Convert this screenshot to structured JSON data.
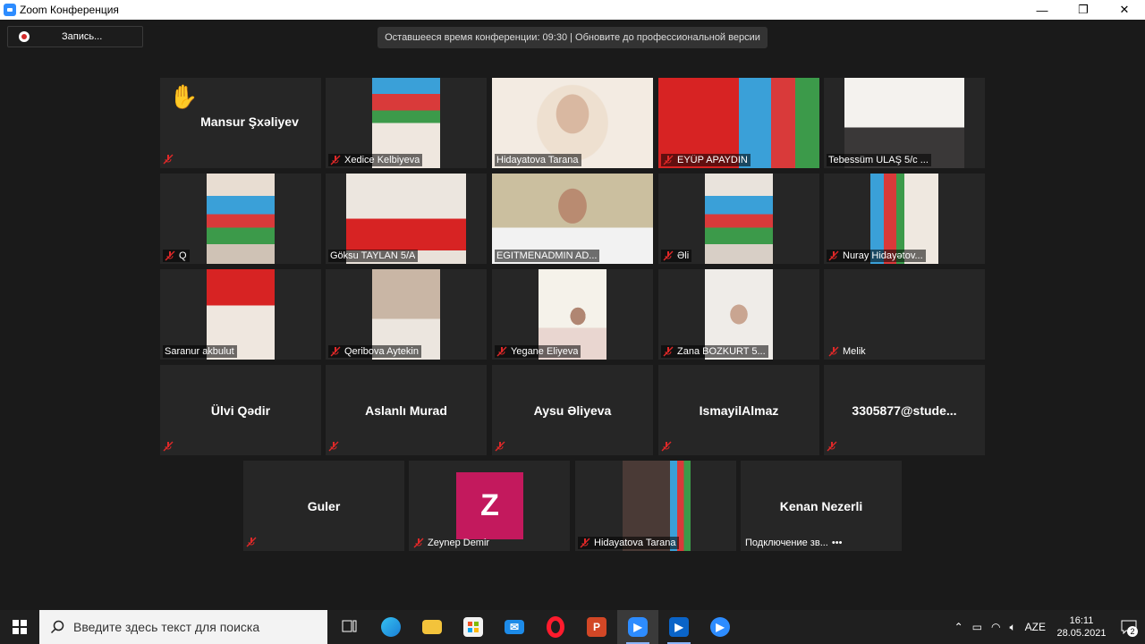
{
  "window": {
    "title": "Zoom Конференция",
    "minimize": "—",
    "restore": "❐",
    "close": "✕"
  },
  "toolbar": {
    "record_label": "Запись..."
  },
  "banner": {
    "text": "Оставшееся время конференции: 09:30 | Обновите до профессиональной версии"
  },
  "participants": [
    {
      "name": "Mansur Şxəliyev",
      "video": false,
      "hand_raised": true,
      "muted": true
    },
    {
      "name": "Xedice Kelbiyeva",
      "video": true,
      "muted": true
    },
    {
      "name": "Hidayatova Tarana",
      "video": true,
      "muted": false
    },
    {
      "name": "EYÜP APAYDIN",
      "video": true,
      "muted": true
    },
    {
      "name": "Tebessüm ULAŞ 5/c ...",
      "video": true,
      "muted": false
    },
    {
      "name": "Q",
      "video": true,
      "muted": true
    },
    {
      "name": "Göksu TAYLAN 5/A",
      "video": true,
      "muted": false
    },
    {
      "name": "EGITMENADMIN AD...",
      "video": true,
      "muted": false,
      "active_speaker": true
    },
    {
      "name": "Əli",
      "video": true,
      "muted": true
    },
    {
      "name": "Nuray Hidayətov...",
      "video": true,
      "muted": true
    },
    {
      "name": "Saranur akbulut",
      "video": true,
      "muted": false
    },
    {
      "name": "Qeribova Aytekin",
      "video": true,
      "muted": true
    },
    {
      "name": "Yegane Eliyeva",
      "video": true,
      "muted": true
    },
    {
      "name": "Zana BOZKURT 5...",
      "video": true,
      "muted": true
    },
    {
      "name": "Melik",
      "video": false,
      "muted": true
    },
    {
      "name": "Ülvi Qədir",
      "video": false,
      "muted": true
    },
    {
      "name": "Aslanlı Murad",
      "video": false,
      "muted": true
    },
    {
      "name": "Aysu Əliyeva",
      "video": false,
      "muted": true
    },
    {
      "name": "IsmayilAlmaz",
      "video": false,
      "muted": true
    },
    {
      "name": "3305877@stude...",
      "video": false,
      "muted": true
    },
    {
      "name": "Guler",
      "video": false,
      "muted": true
    },
    {
      "name": "Zeynep Demir",
      "video": false,
      "avatar_letter": "Z",
      "avatar_color": "#c3195d",
      "muted": true
    },
    {
      "name": "Hidayatova Tarana",
      "video": true,
      "muted": true
    },
    {
      "name": "Kenan Nezerli",
      "video": false,
      "muted": false,
      "status": "Подключение зв...",
      "more": "•••"
    }
  ],
  "taskbar": {
    "search_placeholder": "Введите здесь текст для поиска",
    "apps": [
      "task-view",
      "edge",
      "file-explorer",
      "store",
      "mail",
      "opera",
      "powerpoint",
      "zoom",
      "media-player",
      "zoom-meetings"
    ],
    "language": "AZE",
    "time": "16:11",
    "date": "28.05.2021",
    "notifications": "2"
  },
  "colors": {
    "background": "#1a1a1a",
    "tile": "#262626",
    "active_speaker": "#c9e35a",
    "mute_icon": "#e02828",
    "zoom_blue": "#2d8cff"
  }
}
